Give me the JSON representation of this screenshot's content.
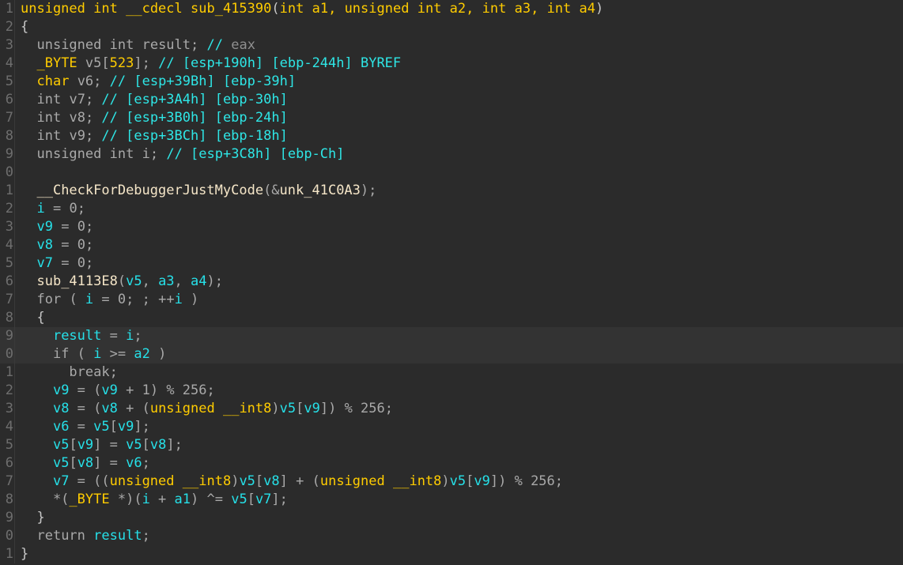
{
  "app": {
    "name": "ida-pseudocode-view",
    "theme": "dark",
    "background": "#2b2b2b",
    "highlight_background": "#333333",
    "gutter_color": "#6e6e6e"
  },
  "palette": {
    "keyword": "#ffcc00",
    "function": "#f5e6c8",
    "variable": "#26e0e8",
    "plain": "#a9a9a9",
    "comment": "#2ee6e6",
    "brace": "#c8c8c8"
  },
  "function": {
    "return_type": "unsigned int",
    "calling_convention": "__cdecl",
    "name": "sub_415390",
    "parameters": [
      "int a1",
      "unsigned int a2",
      "int a3",
      "int a4"
    ]
  },
  "lines": [
    {
      "number": "1",
      "highlighted": false,
      "tokens": [
        {
          "t": "unsigned",
          "c": "kw"
        },
        {
          "t": " ",
          "c": "plain"
        },
        {
          "t": "int",
          "c": "kw"
        },
        {
          "t": " ",
          "c": "plain"
        },
        {
          "t": "__cdecl",
          "c": "kw"
        },
        {
          "t": " ",
          "c": "plain"
        },
        {
          "t": "sub_415390",
          "c": "str"
        },
        {
          "t": "(",
          "c": "brace"
        },
        {
          "t": "int",
          "c": "kw"
        },
        {
          "t": " ",
          "c": "plain"
        },
        {
          "t": "a1",
          "c": "kw"
        },
        {
          "t": ", ",
          "c": "kw"
        },
        {
          "t": "unsigned",
          "c": "kw"
        },
        {
          "t": " ",
          "c": "plain"
        },
        {
          "t": "int",
          "c": "kw"
        },
        {
          "t": " ",
          "c": "plain"
        },
        {
          "t": "a2",
          "c": "kw"
        },
        {
          "t": ", ",
          "c": "kw"
        },
        {
          "t": "int",
          "c": "kw"
        },
        {
          "t": " ",
          "c": "plain"
        },
        {
          "t": "a3",
          "c": "kw"
        },
        {
          "t": ", ",
          "c": "kw"
        },
        {
          "t": "int",
          "c": "kw"
        },
        {
          "t": " ",
          "c": "plain"
        },
        {
          "t": "a4",
          "c": "kw"
        },
        {
          "t": ")",
          "c": "brace"
        }
      ]
    },
    {
      "number": "2",
      "highlighted": false,
      "tokens": [
        {
          "t": "{",
          "c": "brace"
        }
      ]
    },
    {
      "number": "3",
      "highlighted": false,
      "tokens": [
        {
          "t": "  ",
          "c": "plain"
        },
        {
          "t": "unsigned",
          "c": "plain"
        },
        {
          "t": " ",
          "c": "plain"
        },
        {
          "t": "int",
          "c": "plain"
        },
        {
          "t": " ",
          "c": "plain"
        },
        {
          "t": "result",
          "c": "plain"
        },
        {
          "t": "; ",
          "c": "plain"
        },
        {
          "t": "// ",
          "c": "cmt"
        },
        {
          "t": "eax",
          "c": "cmtdim"
        }
      ]
    },
    {
      "number": "4",
      "highlighted": false,
      "tokens": [
        {
          "t": "  ",
          "c": "plain"
        },
        {
          "t": "_BYTE",
          "c": "kw"
        },
        {
          "t": " ",
          "c": "plain"
        },
        {
          "t": "v5",
          "c": "plain"
        },
        {
          "t": "[",
          "c": "plain"
        },
        {
          "t": "523",
          "c": "kw"
        },
        {
          "t": "]",
          "c": "plain"
        },
        {
          "t": "; ",
          "c": "plain"
        },
        {
          "t": "// [esp+190h] [ebp-244h] BYREF",
          "c": "cmt"
        }
      ]
    },
    {
      "number": "5",
      "highlighted": false,
      "tokens": [
        {
          "t": "  ",
          "c": "plain"
        },
        {
          "t": "char",
          "c": "kw"
        },
        {
          "t": " ",
          "c": "plain"
        },
        {
          "t": "v6",
          "c": "plain"
        },
        {
          "t": "; ",
          "c": "plain"
        },
        {
          "t": "// [esp+39Bh] [ebp-39h]",
          "c": "cmt"
        }
      ]
    },
    {
      "number": "6",
      "highlighted": false,
      "tokens": [
        {
          "t": "  ",
          "c": "plain"
        },
        {
          "t": "int",
          "c": "plain"
        },
        {
          "t": " ",
          "c": "plain"
        },
        {
          "t": "v7",
          "c": "plain"
        },
        {
          "t": "; ",
          "c": "plain"
        },
        {
          "t": "// [esp+3A4h] [ebp-30h]",
          "c": "cmt"
        }
      ]
    },
    {
      "number": "7",
      "highlighted": false,
      "tokens": [
        {
          "t": "  ",
          "c": "plain"
        },
        {
          "t": "int",
          "c": "plain"
        },
        {
          "t": " ",
          "c": "plain"
        },
        {
          "t": "v8",
          "c": "plain"
        },
        {
          "t": "; ",
          "c": "plain"
        },
        {
          "t": "// [esp+3B0h] [ebp-24h]",
          "c": "cmt"
        }
      ]
    },
    {
      "number": "8",
      "highlighted": false,
      "tokens": [
        {
          "t": "  ",
          "c": "plain"
        },
        {
          "t": "int",
          "c": "plain"
        },
        {
          "t": " ",
          "c": "plain"
        },
        {
          "t": "v9",
          "c": "plain"
        },
        {
          "t": "; ",
          "c": "plain"
        },
        {
          "t": "// [esp+3BCh] [ebp-18h]",
          "c": "cmt"
        }
      ]
    },
    {
      "number": "9",
      "highlighted": false,
      "tokens": [
        {
          "t": "  ",
          "c": "plain"
        },
        {
          "t": "unsigned",
          "c": "plain"
        },
        {
          "t": " ",
          "c": "plain"
        },
        {
          "t": "int",
          "c": "plain"
        },
        {
          "t": " ",
          "c": "plain"
        },
        {
          "t": "i",
          "c": "plain"
        },
        {
          "t": "; ",
          "c": "plain"
        },
        {
          "t": "// [esp+3C8h] [ebp-Ch]",
          "c": "cmt"
        }
      ]
    },
    {
      "number": "0",
      "highlighted": false,
      "tokens": []
    },
    {
      "number": "1",
      "highlighted": false,
      "tokens": [
        {
          "t": "  ",
          "c": "plain"
        },
        {
          "t": "__CheckForDebuggerJustMyCode",
          "c": "fn"
        },
        {
          "t": "(&",
          "c": "plain"
        },
        {
          "t": "unk_41C0A3",
          "c": "fn"
        },
        {
          "t": ");",
          "c": "plain"
        }
      ]
    },
    {
      "number": "2",
      "highlighted": false,
      "tokens": [
        {
          "t": "  ",
          "c": "plain"
        },
        {
          "t": "i",
          "c": "var"
        },
        {
          "t": " = ",
          "c": "plain"
        },
        {
          "t": "0",
          "c": "num"
        },
        {
          "t": ";",
          "c": "plain"
        }
      ]
    },
    {
      "number": "3",
      "highlighted": false,
      "tokens": [
        {
          "t": "  ",
          "c": "plain"
        },
        {
          "t": "v9",
          "c": "var"
        },
        {
          "t": " = ",
          "c": "plain"
        },
        {
          "t": "0",
          "c": "num"
        },
        {
          "t": ";",
          "c": "plain"
        }
      ]
    },
    {
      "number": "4",
      "highlighted": false,
      "tokens": [
        {
          "t": "  ",
          "c": "plain"
        },
        {
          "t": "v8",
          "c": "var"
        },
        {
          "t": " = ",
          "c": "plain"
        },
        {
          "t": "0",
          "c": "num"
        },
        {
          "t": ";",
          "c": "plain"
        }
      ]
    },
    {
      "number": "5",
      "highlighted": false,
      "tokens": [
        {
          "t": "  ",
          "c": "plain"
        },
        {
          "t": "v7",
          "c": "var"
        },
        {
          "t": " = ",
          "c": "plain"
        },
        {
          "t": "0",
          "c": "num"
        },
        {
          "t": ";",
          "c": "plain"
        }
      ]
    },
    {
      "number": "6",
      "highlighted": false,
      "tokens": [
        {
          "t": "  ",
          "c": "plain"
        },
        {
          "t": "sub_4113E8",
          "c": "fn"
        },
        {
          "t": "(",
          "c": "plain"
        },
        {
          "t": "v5",
          "c": "var"
        },
        {
          "t": ", ",
          "c": "plain"
        },
        {
          "t": "a3",
          "c": "var"
        },
        {
          "t": ", ",
          "c": "plain"
        },
        {
          "t": "a4",
          "c": "var"
        },
        {
          "t": ");",
          "c": "plain"
        }
      ]
    },
    {
      "number": "7",
      "highlighted": false,
      "tokens": [
        {
          "t": "  ",
          "c": "plain"
        },
        {
          "t": "for",
          "c": "ctl"
        },
        {
          "t": " ( ",
          "c": "plain"
        },
        {
          "t": "i",
          "c": "var"
        },
        {
          "t": " = ",
          "c": "plain"
        },
        {
          "t": "0",
          "c": "num"
        },
        {
          "t": "; ; ++",
          "c": "plain"
        },
        {
          "t": "i",
          "c": "var"
        },
        {
          "t": " )",
          "c": "plain"
        }
      ]
    },
    {
      "number": "8",
      "highlighted": false,
      "tokens": [
        {
          "t": "  ",
          "c": "plain"
        },
        {
          "t": "{",
          "c": "brace"
        }
      ]
    },
    {
      "number": "9",
      "highlighted": true,
      "tokens": [
        {
          "t": "    ",
          "c": "plain"
        },
        {
          "t": "result",
          "c": "var"
        },
        {
          "t": " = ",
          "c": "plain"
        },
        {
          "t": "i",
          "c": "var"
        },
        {
          "t": ";",
          "c": "plain"
        }
      ]
    },
    {
      "number": "0",
      "highlighted": true,
      "tokens": [
        {
          "t": "    ",
          "c": "plain"
        },
        {
          "t": "if",
          "c": "ctl"
        },
        {
          "t": " ( ",
          "c": "plain"
        },
        {
          "t": "i",
          "c": "var"
        },
        {
          "t": " >= ",
          "c": "plain"
        },
        {
          "t": "a2",
          "c": "var"
        },
        {
          "t": " )",
          "c": "plain"
        }
      ]
    },
    {
      "number": "1",
      "highlighted": false,
      "tokens": [
        {
          "t": "      ",
          "c": "plain"
        },
        {
          "t": "break",
          "c": "ctl"
        },
        {
          "t": ";",
          "c": "plain"
        }
      ]
    },
    {
      "number": "2",
      "highlighted": false,
      "tokens": [
        {
          "t": "    ",
          "c": "plain"
        },
        {
          "t": "v9",
          "c": "var"
        },
        {
          "t": " = (",
          "c": "plain"
        },
        {
          "t": "v9",
          "c": "var"
        },
        {
          "t": " + ",
          "c": "plain"
        },
        {
          "t": "1",
          "c": "num"
        },
        {
          "t": ") % ",
          "c": "plain"
        },
        {
          "t": "256",
          "c": "num"
        },
        {
          "t": ";",
          "c": "plain"
        }
      ]
    },
    {
      "number": "3",
      "highlighted": false,
      "tokens": [
        {
          "t": "    ",
          "c": "plain"
        },
        {
          "t": "v8",
          "c": "var"
        },
        {
          "t": " = (",
          "c": "plain"
        },
        {
          "t": "v8",
          "c": "var"
        },
        {
          "t": " + (",
          "c": "plain"
        },
        {
          "t": "unsigned",
          "c": "kw"
        },
        {
          "t": " ",
          "c": "plain"
        },
        {
          "t": "__int8",
          "c": "kw"
        },
        {
          "t": ")",
          "c": "plain"
        },
        {
          "t": "v5",
          "c": "var"
        },
        {
          "t": "[",
          "c": "plain"
        },
        {
          "t": "v9",
          "c": "var"
        },
        {
          "t": "]) % ",
          "c": "plain"
        },
        {
          "t": "256",
          "c": "num"
        },
        {
          "t": ";",
          "c": "plain"
        }
      ]
    },
    {
      "number": "4",
      "highlighted": false,
      "tokens": [
        {
          "t": "    ",
          "c": "plain"
        },
        {
          "t": "v6",
          "c": "var"
        },
        {
          "t": " = ",
          "c": "plain"
        },
        {
          "t": "v5",
          "c": "var"
        },
        {
          "t": "[",
          "c": "plain"
        },
        {
          "t": "v9",
          "c": "var"
        },
        {
          "t": "];",
          "c": "plain"
        }
      ]
    },
    {
      "number": "5",
      "highlighted": false,
      "tokens": [
        {
          "t": "    ",
          "c": "plain"
        },
        {
          "t": "v5",
          "c": "var"
        },
        {
          "t": "[",
          "c": "plain"
        },
        {
          "t": "v9",
          "c": "var"
        },
        {
          "t": "] = ",
          "c": "plain"
        },
        {
          "t": "v5",
          "c": "var"
        },
        {
          "t": "[",
          "c": "plain"
        },
        {
          "t": "v8",
          "c": "var"
        },
        {
          "t": "];",
          "c": "plain"
        }
      ]
    },
    {
      "number": "6",
      "highlighted": false,
      "tokens": [
        {
          "t": "    ",
          "c": "plain"
        },
        {
          "t": "v5",
          "c": "var"
        },
        {
          "t": "[",
          "c": "plain"
        },
        {
          "t": "v8",
          "c": "var"
        },
        {
          "t": "] = ",
          "c": "plain"
        },
        {
          "t": "v6",
          "c": "var"
        },
        {
          "t": ";",
          "c": "plain"
        }
      ]
    },
    {
      "number": "7",
      "highlighted": false,
      "tokens": [
        {
          "t": "    ",
          "c": "plain"
        },
        {
          "t": "v7",
          "c": "var"
        },
        {
          "t": " = ((",
          "c": "plain"
        },
        {
          "t": "unsigned",
          "c": "kw"
        },
        {
          "t": " ",
          "c": "plain"
        },
        {
          "t": "__int8",
          "c": "kw"
        },
        {
          "t": ")",
          "c": "plain"
        },
        {
          "t": "v5",
          "c": "var"
        },
        {
          "t": "[",
          "c": "plain"
        },
        {
          "t": "v8",
          "c": "var"
        },
        {
          "t": "] + (",
          "c": "plain"
        },
        {
          "t": "unsigned",
          "c": "kw"
        },
        {
          "t": " ",
          "c": "plain"
        },
        {
          "t": "__int8",
          "c": "kw"
        },
        {
          "t": ")",
          "c": "plain"
        },
        {
          "t": "v5",
          "c": "var"
        },
        {
          "t": "[",
          "c": "plain"
        },
        {
          "t": "v9",
          "c": "var"
        },
        {
          "t": "]) % ",
          "c": "plain"
        },
        {
          "t": "256",
          "c": "num"
        },
        {
          "t": ";",
          "c": "plain"
        }
      ]
    },
    {
      "number": "8",
      "highlighted": false,
      "tokens": [
        {
          "t": "    *(",
          "c": "plain"
        },
        {
          "t": "_BYTE",
          "c": "kw"
        },
        {
          "t": " *)(",
          "c": "plain"
        },
        {
          "t": "i",
          "c": "var"
        },
        {
          "t": " + ",
          "c": "plain"
        },
        {
          "t": "a1",
          "c": "var"
        },
        {
          "t": ") ^= ",
          "c": "plain"
        },
        {
          "t": "v5",
          "c": "var"
        },
        {
          "t": "[",
          "c": "plain"
        },
        {
          "t": "v7",
          "c": "var"
        },
        {
          "t": "];",
          "c": "plain"
        }
      ]
    },
    {
      "number": "9",
      "highlighted": false,
      "tokens": [
        {
          "t": "  ",
          "c": "plain"
        },
        {
          "t": "}",
          "c": "brace"
        }
      ]
    },
    {
      "number": "0",
      "highlighted": false,
      "tokens": [
        {
          "t": "  ",
          "c": "plain"
        },
        {
          "t": "return",
          "c": "ctl"
        },
        {
          "t": " ",
          "c": "plain"
        },
        {
          "t": "result",
          "c": "var"
        },
        {
          "t": ";",
          "c": "plain"
        }
      ]
    },
    {
      "number": "1",
      "highlighted": false,
      "tokens": [
        {
          "t": "}",
          "c": "brace"
        }
      ]
    }
  ]
}
